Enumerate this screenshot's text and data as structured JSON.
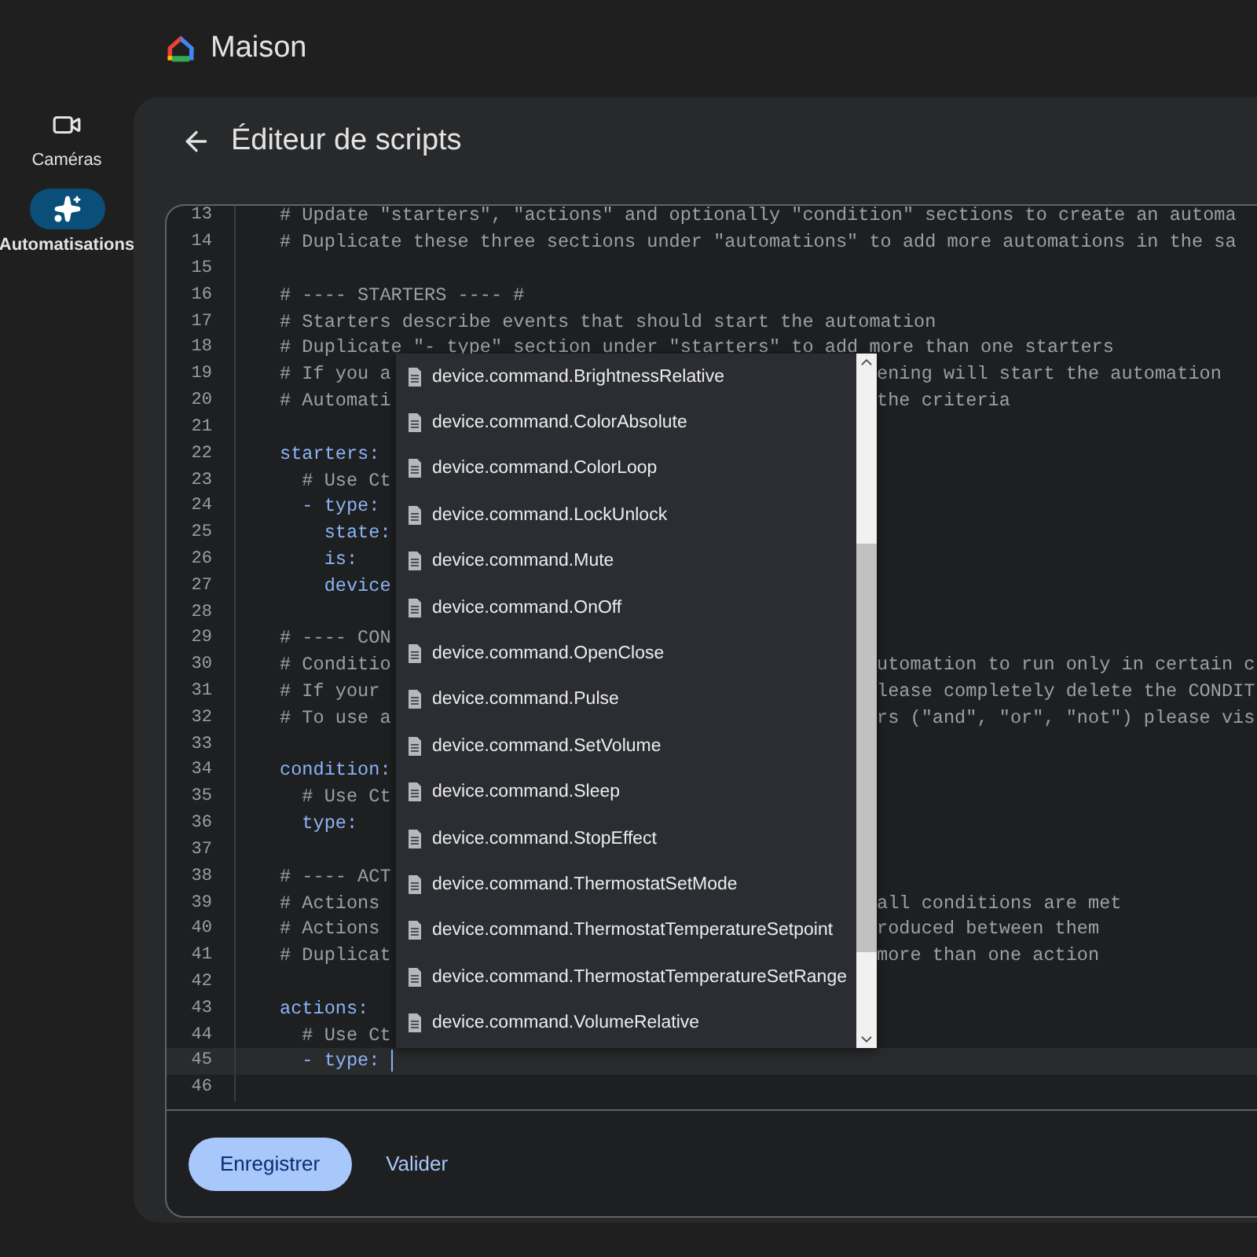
{
  "app": {
    "title": "Maison"
  },
  "sidebar": {
    "items": [
      {
        "label": "Caméras",
        "selected": false
      },
      {
        "label": "Automatisations",
        "selected": true
      }
    ]
  },
  "page": {
    "title": "Éditeur de scripts"
  },
  "editor": {
    "lines": [
      {
        "number": "13",
        "kind": "comment",
        "text": "# Update \"starters\", \"actions\" and optionally \"condition\" sections to create an automa",
        "current": false
      },
      {
        "number": "14",
        "kind": "comment",
        "text": "# Duplicate these three sections under \"automations\" to add more automations in the sa",
        "current": false
      },
      {
        "number": "15",
        "current": false
      },
      {
        "number": "16",
        "kind": "comment",
        "text": "# ---- STARTERS ---- #",
        "current": false
      },
      {
        "number": "17",
        "kind": "comment",
        "text": "# Starters describe events that should start the automation",
        "current": false
      },
      {
        "number": "18",
        "kind": "comment",
        "text": "# Duplicate \"- type\" section under \"starters\" to add more than one starters",
        "current": false
      },
      {
        "number": "19",
        "kind": "comment",
        "text": "# If you a",
        "tail": "ening will start the automation",
        "current": false
      },
      {
        "number": "20",
        "kind": "comment",
        "text": "# Automati",
        "tail": "the criteria",
        "current": false
      },
      {
        "number": "21",
        "current": false
      },
      {
        "number": "22",
        "kind": "key",
        "text": "starters:",
        "current": false
      },
      {
        "number": "23",
        "kind": "comment",
        "text": "  # Use Ct",
        "current": false
      },
      {
        "number": "24",
        "kind": "key",
        "text": "  - type:",
        "current": false
      },
      {
        "number": "25",
        "kind": "key",
        "text": "    state:",
        "current": false
      },
      {
        "number": "26",
        "kind": "key",
        "text": "    is:",
        "current": false
      },
      {
        "number": "27",
        "kind": "key",
        "text": "    device",
        "current": false
      },
      {
        "number": "28",
        "current": false
      },
      {
        "number": "29",
        "kind": "comment",
        "text": "# ---- CON",
        "current": false
      },
      {
        "number": "30",
        "kind": "comment",
        "text": "# Conditio",
        "tail": "utomation to run only in certain c",
        "current": false
      },
      {
        "number": "31",
        "kind": "comment",
        "text": "# If your",
        "tail": "lease completely delete the CONDIT",
        "current": false
      },
      {
        "number": "32",
        "kind": "comment",
        "text": "# To use a",
        "tail": "rs (\"and\", \"or\", \"not\") please vis",
        "current": false
      },
      {
        "number": "33",
        "current": false
      },
      {
        "number": "34",
        "kind": "key",
        "text": "condition:",
        "current": false
      },
      {
        "number": "35",
        "kind": "comment",
        "text": "  # Use Ct",
        "current": false
      },
      {
        "number": "36",
        "kind": "key",
        "text": "  type:",
        "current": false
      },
      {
        "number": "37",
        "current": false
      },
      {
        "number": "38",
        "kind": "comment",
        "text": "# ---- ACT",
        "current": false
      },
      {
        "number": "39",
        "kind": "comment",
        "text": "# Actions",
        "tail": "all conditions are met",
        "current": false
      },
      {
        "number": "40",
        "kind": "comment",
        "text": "# Actions",
        "tail": "roduced between them",
        "current": false
      },
      {
        "number": "41",
        "kind": "comment",
        "text": "# Duplicat",
        "tail": "more than one action",
        "current": false
      },
      {
        "number": "42",
        "current": false
      },
      {
        "number": "43",
        "kind": "key",
        "text": "actions:",
        "current": false
      },
      {
        "number": "44",
        "kind": "comment",
        "text": "  # Use Ct",
        "current": false
      },
      {
        "number": "45",
        "kind": "key",
        "text": "  - type:",
        "current": true
      },
      {
        "number": "46",
        "current": false
      }
    ],
    "suggestions": [
      "device.command.BrightnessRelative",
      "device.command.ColorAbsolute",
      "device.command.ColorLoop",
      "device.command.LockUnlock",
      "device.command.Mute",
      "device.command.OnOff",
      "device.command.OpenClose",
      "device.command.Pulse",
      "device.command.SetVolume",
      "device.command.Sleep",
      "device.command.StopEffect",
      "device.command.ThermostatSetMode",
      "device.command.ThermostatTemperatureSetpoint",
      "device.command.ThermostatTemperatureSetRange",
      "device.command.VolumeRelative"
    ]
  },
  "buttons": [
    {
      "label": "Enregistrer",
      "kind": "filled"
    },
    {
      "label": "Valider",
      "kind": "text"
    }
  ]
}
